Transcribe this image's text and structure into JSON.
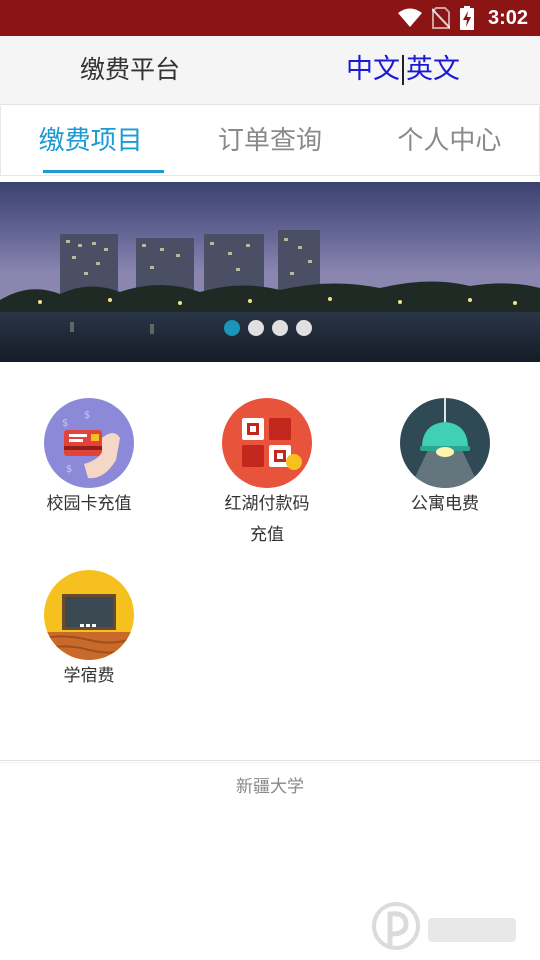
{
  "status_bar": {
    "time": "3:02",
    "icons": [
      "wifi-icon",
      "no-sim-icon",
      "battery-charging-icon"
    ]
  },
  "header": {
    "title": "缴费平台",
    "lang_zh": "中文",
    "lang_en": "英文"
  },
  "tabs": [
    {
      "label": "缴费项目",
      "active": true
    },
    {
      "label": "订单查询",
      "active": false
    },
    {
      "label": "个人中心",
      "active": false
    }
  ],
  "banner": {
    "slides": 4,
    "active_index": 0
  },
  "items": [
    {
      "label_line1": "校园卡充值",
      "label_line2": "",
      "icon": "campus-card-icon",
      "color": "#8c8ad8"
    },
    {
      "label_line1": "红湖付款码",
      "label_line2": "充值",
      "icon": "qr-code-icon",
      "color": "#e8533b"
    },
    {
      "label_line1": "公寓电费",
      "label_line2": "",
      "icon": "lamp-icon",
      "color": "#2f4a55"
    },
    {
      "label_line1": "学宿费",
      "label_line2": "",
      "icon": "blackboard-icon",
      "color": "#f6c11e"
    }
  ],
  "footer": {
    "text": "新疆大学"
  },
  "colors": {
    "status_bar": "#8b1414",
    "accent": "#1b9ad4",
    "lang": "#1a1ad6"
  }
}
